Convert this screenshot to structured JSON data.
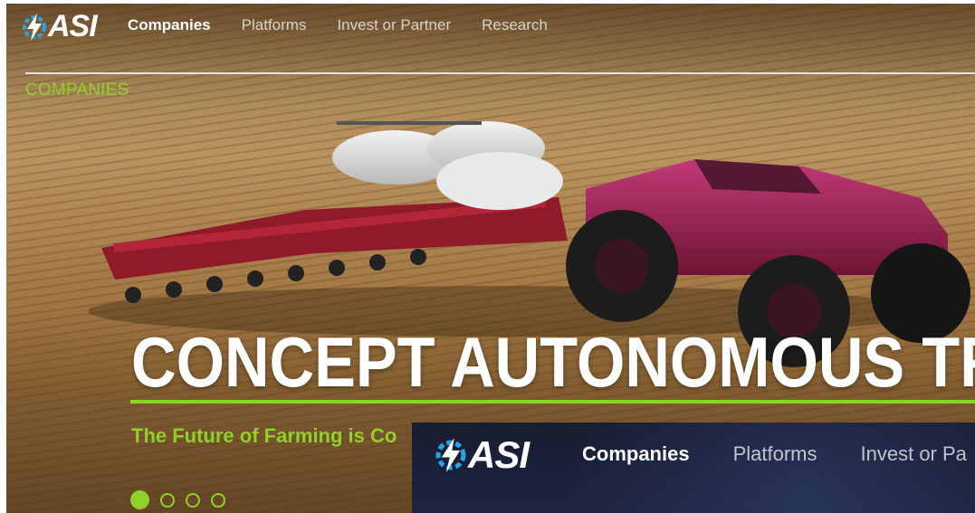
{
  "brand": {
    "wordmark": "ASI",
    "logo_icon": "gear-bolt-icon",
    "accent": "#8fd129",
    "sticky_bg": "#1a203a"
  },
  "nav": {
    "items": [
      {
        "label": "Companies",
        "active": true
      },
      {
        "label": "Platforms",
        "active": false
      },
      {
        "label": "Invest or Partner",
        "active": false
      },
      {
        "label": "Research",
        "active": false
      }
    ]
  },
  "section_label": "COMPANIES",
  "slide": {
    "headline": "CONCEPT AUTONOMOUS TR",
    "subhead": "The Future of Farming is Co",
    "image_subject": "red autonomous tractor pulling a planter in a field"
  },
  "carousel": {
    "total": 4,
    "active_index": 0
  },
  "sticky_nav": {
    "items": [
      {
        "label": "Companies",
        "active": true
      },
      {
        "label": "Platforms",
        "active": false
      },
      {
        "label": "Invest or Pa",
        "active": false
      }
    ]
  }
}
